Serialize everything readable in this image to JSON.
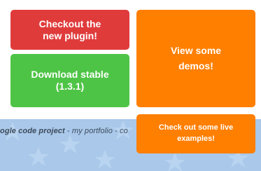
{
  "buttons": {
    "plugin": {
      "line1": "Checkout the",
      "line2": "new plugin!"
    },
    "download": {
      "line1": "Download stable",
      "line2": "(1.3.1)"
    },
    "demos": {
      "line1": "View some",
      "line2": "demos!"
    },
    "examples": {
      "line1": "Check out some live",
      "line2": "examples!"
    }
  },
  "footer": {
    "project_link": "ogle code project",
    "separator1": " - ",
    "portfolio_link": "my portfolio",
    "separator2": " - ",
    "trailing": "co"
  },
  "colors": {
    "red": "#e03b3b",
    "green": "#4ec446",
    "orange": "#ff7f00",
    "footer_blue": "#a9c8ea"
  }
}
